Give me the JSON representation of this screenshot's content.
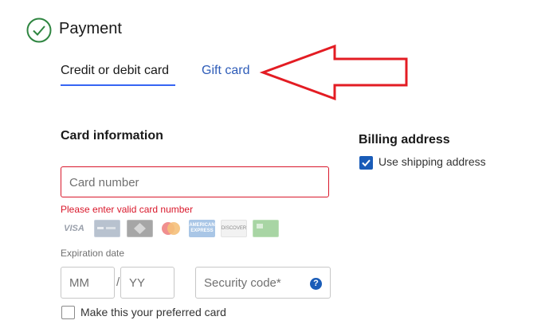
{
  "section": {
    "title": "Payment"
  },
  "tabs": [
    {
      "label": "Credit or debit card",
      "active": true
    },
    {
      "label": "Gift card",
      "active": false
    }
  ],
  "card_info": {
    "title": "Card information",
    "card_number_placeholder": "Card number",
    "error": "Please enter valid card number",
    "accepted_cards": [
      "VISA",
      "generic-card",
      "generic-card",
      "mastercard",
      "AMERICAN EXPRESS",
      "DISCOVER",
      "generic-card"
    ],
    "expiration_label": "Expiration date",
    "month_placeholder": "MM",
    "separator": "/",
    "year_placeholder": "YY",
    "security_placeholder": "Security code*",
    "help_symbol": "?",
    "preferred_label": "Make this your preferred card",
    "preferred_checked": false
  },
  "billing": {
    "title": "Billing address",
    "use_shipping_label": "Use shipping address",
    "use_shipping_checked": true
  },
  "colors": {
    "success": "#2e8540",
    "link": "#2e5cb8",
    "error": "#d9182b",
    "annotation_arrow": "#e31c23",
    "checkbox": "#1a5cb8"
  }
}
